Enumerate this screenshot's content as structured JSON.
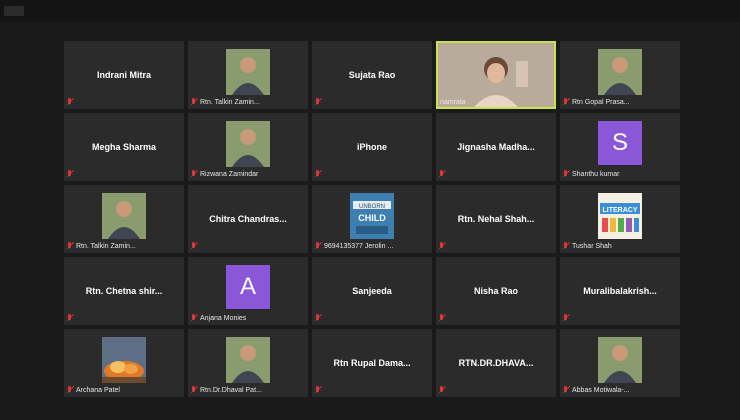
{
  "window": {
    "menu_icon": "window-menu-icon"
  },
  "tiles": [
    {
      "kind": "text",
      "name": "Indrani Mitra"
    },
    {
      "kind": "photo",
      "image": "person-portrait-icon",
      "label": "Rtn. Talkin Zamin..."
    },
    {
      "kind": "text",
      "name": "Sujata Rao"
    },
    {
      "kind": "video",
      "image": "webcam-video-icon",
      "label": "namrata",
      "active": true
    },
    {
      "kind": "photo",
      "image": "person-portrait-icon",
      "label": "Rtn Gopal Prasa..."
    },
    {
      "kind": "text",
      "name": "Megha Sharma"
    },
    {
      "kind": "photo",
      "image": "person-portrait-icon",
      "label": "Rizwana Zamindar"
    },
    {
      "kind": "text",
      "name": "iPhone"
    },
    {
      "kind": "text",
      "name": "Jignasha Madha..."
    },
    {
      "kind": "initial",
      "initial": "S",
      "label": "Shanthu kumar"
    },
    {
      "kind": "photo",
      "image": "person-portrait-icon",
      "label": "Rtn. Talkin Zamin..."
    },
    {
      "kind": "text",
      "name": "Chitra Chandras..."
    },
    {
      "kind": "photo",
      "image": "book-cover-icon",
      "label": "9694135377 Jerolin ..."
    },
    {
      "kind": "text",
      "name": "Rtn. Nehal Shah..."
    },
    {
      "kind": "photo",
      "image": "literacy-banner-icon",
      "label": "Tushar Shah"
    },
    {
      "kind": "text",
      "name": "Rtn. Chetna shir..."
    },
    {
      "kind": "initial",
      "initial": "A",
      "label": "Anjana Monies"
    },
    {
      "kind": "text",
      "name": "Sanjeeda"
    },
    {
      "kind": "text",
      "name": "Nisha Rao"
    },
    {
      "kind": "text",
      "name": "Muralibalakrish..."
    },
    {
      "kind": "photo",
      "image": "fire-image-icon",
      "label": "Archana Patel"
    },
    {
      "kind": "photo",
      "image": "person-portrait-icon",
      "label": "Rtn.Dr.Dhaval Pat..."
    },
    {
      "kind": "text",
      "name": "Rtn Rupal Dama..."
    },
    {
      "kind": "text",
      "name": "RTN.DR.DHAVA..."
    },
    {
      "kind": "photo",
      "image": "person-portrait-icon",
      "label": "Abbas Motiwala-..."
    }
  ],
  "colors": {
    "tile_bg": "#2b2b2b",
    "active_border": "#c8e24a",
    "mute_red": "#d83a3a",
    "avatar_purple": "#8a57d8"
  }
}
